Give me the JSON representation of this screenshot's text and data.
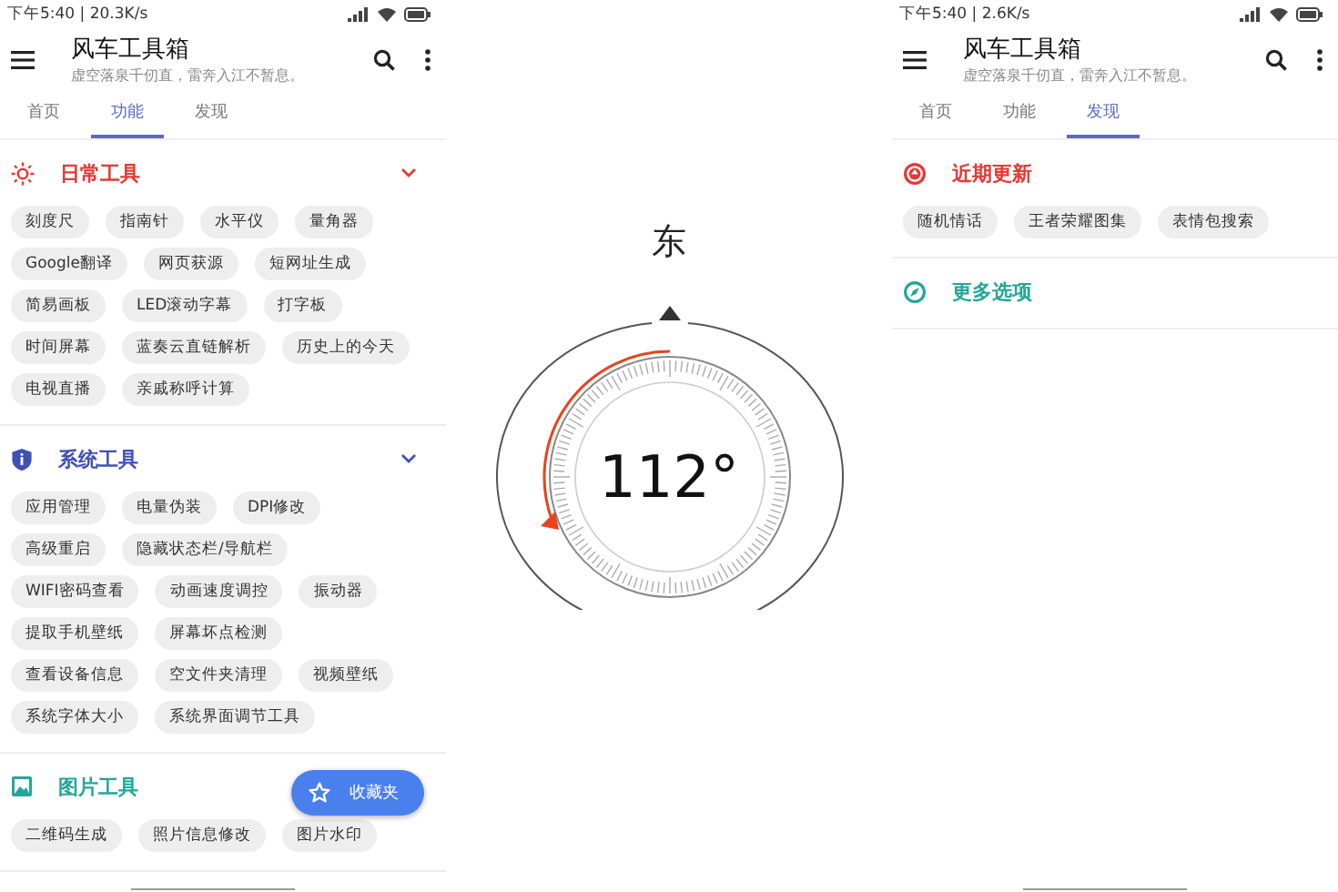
{
  "phones": [
    {
      "kind": "app",
      "status": {
        "time": "下午5:40 | 20.3K/s"
      },
      "app_bar": {
        "title": "风车工具箱",
        "subtitle": "虚空落泉千仞直，雷奔入江不暂息。"
      },
      "tabs": [
        {
          "label": "首页",
          "selected": false
        },
        {
          "label": "功能",
          "selected": true
        },
        {
          "label": "发现",
          "selected": false
        }
      ],
      "sections": [
        {
          "kind": "sun",
          "title": "日常工具",
          "color": "#e53935",
          "expanded": true,
          "chips": [
            "刻度尺",
            "指南针",
            "水平仪",
            "量角器",
            "Google翻译",
            "网页获源",
            "短网址生成",
            "简易画板",
            "LED滚动字幕",
            "打字板",
            "时间屏幕",
            "蓝奏云直链解析",
            "历史上的今天",
            "电视直播",
            "亲戚称呼计算"
          ]
        },
        {
          "kind": "shield",
          "title": "系统工具",
          "color": "#3f51b5",
          "expanded": true,
          "chips": [
            "应用管理",
            "电量伪装",
            "DPI修改",
            "高级重启",
            "隐藏状态栏/导航栏",
            "WIFI密码查看",
            "动画速度调控",
            "振动器",
            "提取手机壁纸",
            "屏幕坏点检测",
            "查看设备信息",
            "空文件夹清理",
            "视频壁纸",
            "系统字体大小",
            "系统界面调节工具"
          ]
        },
        {
          "kind": "image",
          "title": "图片工具",
          "color": "#26a69a",
          "chips": [
            "二维码生成",
            "照片信息修改",
            "图片水印"
          ]
        }
      ],
      "fab": {
        "label": "收藏夹"
      }
    },
    {
      "kind": "compass",
      "direction": "东",
      "heading": "112°"
    },
    {
      "kind": "app",
      "status": {
        "time": "下午5:40 | 2.6K/s"
      },
      "app_bar": {
        "title": "风车工具箱",
        "subtitle": "虚空落泉千仞直，雷奔入江不暂息。"
      },
      "tabs": [
        {
          "label": "首页",
          "selected": false
        },
        {
          "label": "功能",
          "selected": false
        },
        {
          "label": "发现",
          "selected": true
        }
      ],
      "sections": [
        {
          "kind": "update",
          "title": "近期更新",
          "color": "#e53935",
          "chips": [
            "随机情话",
            "王者荣耀图集",
            "表情包搜索"
          ]
        },
        {
          "kind": "compass",
          "title": "更多选项",
          "color": "#26a69a"
        }
      ]
    }
  ]
}
